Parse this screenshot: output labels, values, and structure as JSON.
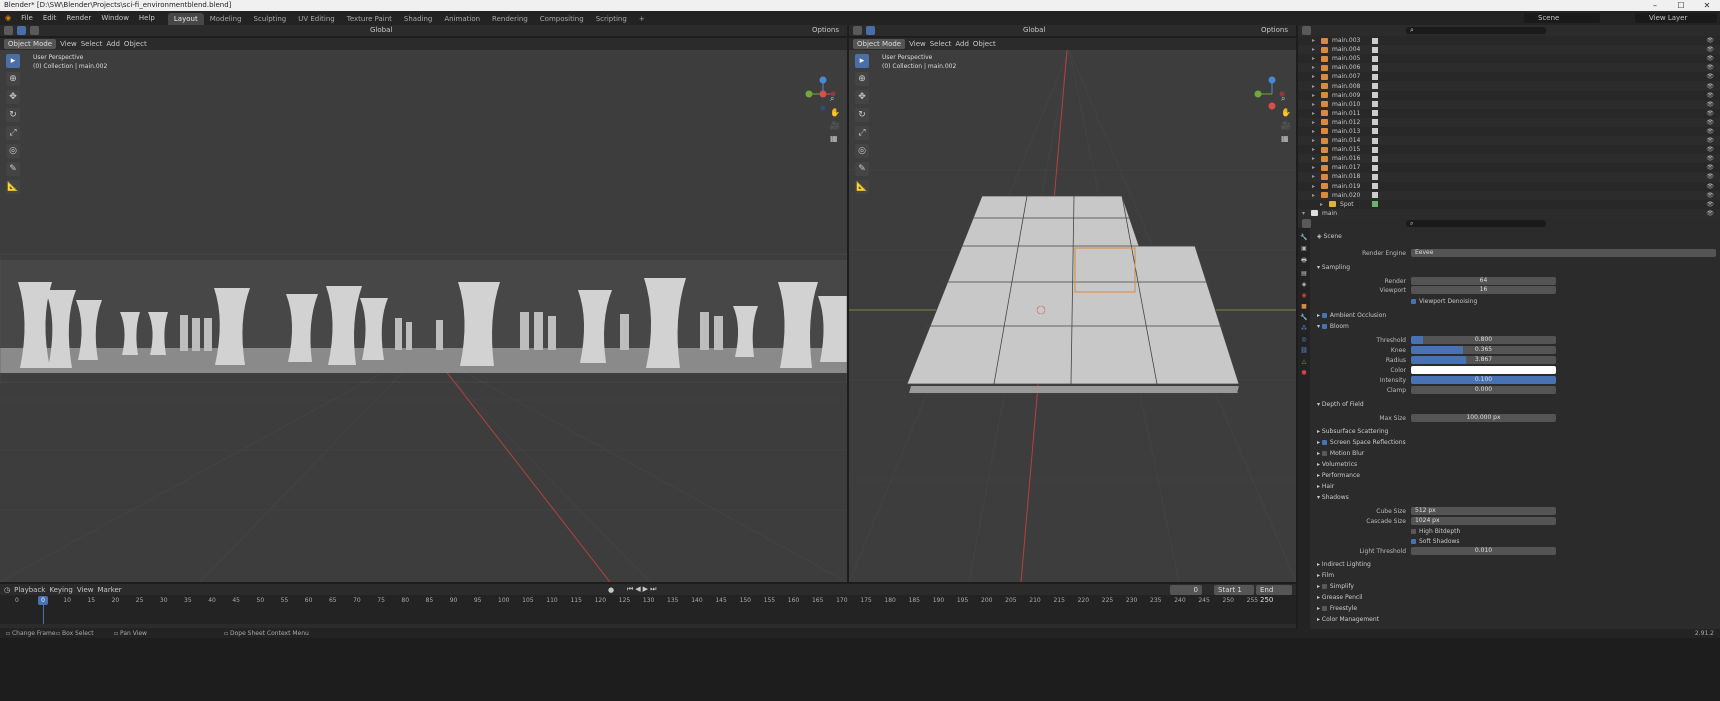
{
  "title": "Blender* [D:\\SW\\Blender\\Projects\\sci-fi_environmentblend.blend]",
  "menus": [
    "File",
    "Edit",
    "Render",
    "Window",
    "Help"
  ],
  "workspaces": [
    "Layout",
    "Modeling",
    "Sculpting",
    "UV Editing",
    "Texture Paint",
    "Shading",
    "Animation",
    "Rendering",
    "Compositing",
    "Scripting"
  ],
  "active_workspace": "Layout",
  "scene": "Scene",
  "view_layer": "View Layer",
  "viewport_left": {
    "mode": "Object Mode",
    "menus": [
      "View",
      "Select",
      "Add",
      "Object"
    ],
    "orientation": "Global",
    "options": "Options",
    "perspective": "User Perspective",
    "collection": "(0) Collection | main.002"
  },
  "viewport_right": {
    "mode": "Object Mode",
    "menus": [
      "View",
      "Select",
      "Add",
      "Object"
    ],
    "orientation": "Global",
    "options": "Options",
    "perspective": "User Perspective",
    "collection": "(0) Collection | main.002"
  },
  "outliner": [
    "main.003",
    "main.004",
    "main.005",
    "main.006",
    "main.007",
    "main.008",
    "main.009",
    "main.010",
    "main.011",
    "main.012",
    "main.013",
    "main.014",
    "main.015",
    "main.016",
    "main.017",
    "main.018",
    "main.019",
    "main.020",
    "Spot",
    "main"
  ],
  "properties": {
    "header": "Scene",
    "render_engine_label": "Render Engine",
    "render_engine": "Eevee",
    "sampling": "Sampling",
    "render_label": "Render",
    "render_val": "64",
    "viewport_label": "Viewport",
    "viewport_val": "16",
    "viewport_denoising": "Viewport Denoising",
    "ambient_occlusion": "Ambient Occlusion",
    "bloom": "Bloom",
    "threshold_label": "Threshold",
    "threshold_val": "0.800",
    "threshold_frac": 0.08,
    "knee_label": "Knee",
    "knee_val": "0.365",
    "knee_frac": 0.36,
    "radius_label": "Radius",
    "radius_val": "3.867",
    "radius_frac": 0.38,
    "color_label": "Color",
    "intensity_label": "Intensity",
    "intensity_val": "0.100",
    "intensity_frac": 1.0,
    "clamp_label": "Clamp",
    "clamp_val": "0.000",
    "dof": "Depth of Field",
    "maxsize_label": "Max Size",
    "maxsize_val": "100.000 px",
    "sss": "Subsurface Scattering",
    "ssr": "Screen Space Reflections",
    "motion_blur": "Motion Blur",
    "volumetrics": "Volumetrics",
    "performance": "Performance",
    "hair": "Hair",
    "shadows": "Shadows",
    "cube_label": "Cube Size",
    "cube_val": "512 px",
    "cascade_label": "Cascade Size",
    "cascade_val": "1024 px",
    "high_bit": "High Bitdepth",
    "soft_shadows": "Soft Shadows",
    "light_thr_label": "Light Threshold",
    "light_thr_val": "0.010",
    "indirect": "Indirect Lighting",
    "film": "Film",
    "simplify": "Simplify",
    "grease": "Grease Pencil",
    "freestyle": "Freestyle",
    "color_mgmt": "Color Management"
  },
  "timeline": {
    "menus": [
      "Playback",
      "Keying",
      "View",
      "Marker"
    ],
    "current": "0",
    "start_label": "Start",
    "start": "1",
    "end_label": "End",
    "end": "250",
    "ticks": [
      "0",
      "5",
      "10",
      "15",
      "20",
      "25",
      "30",
      "35",
      "40",
      "45",
      "50",
      "55",
      "60",
      "65",
      "70",
      "75",
      "80",
      "85",
      "90",
      "95",
      "100",
      "105",
      "110",
      "115",
      "120",
      "125",
      "130",
      "135",
      "140",
      "145",
      "150",
      "155",
      "160",
      "165",
      "170",
      "175",
      "180",
      "185",
      "190",
      "195",
      "200",
      "205",
      "210",
      "215",
      "220",
      "225",
      "230",
      "235",
      "240",
      "245",
      "250",
      "255"
    ],
    "frame_marker": "0"
  },
  "status": {
    "change_frame": "Change Frame",
    "box_select": "Box Select",
    "pan_view": "Pan View",
    "context": "Dope Sheet Context Menu",
    "version": "2.91.2"
  }
}
